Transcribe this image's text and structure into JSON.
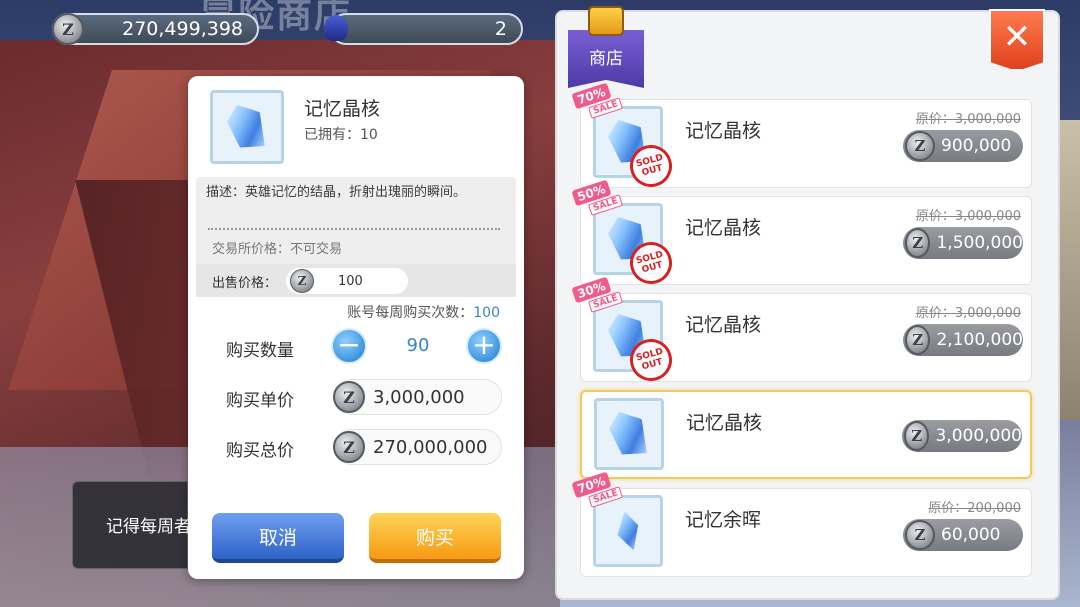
{
  "header": {
    "title": "冒险商店",
    "zeny_amount": "270,499,398",
    "token_amount": "2"
  },
  "detail": {
    "name": "记忆晶核",
    "owned": "已拥有：10",
    "description": "描述：英雄记忆的结晶，折射出瑰丽的瞬间。",
    "trade_price": "交易所价格：不可交易",
    "sell_label": "出售价格：",
    "sell_value": "100",
    "weekly_label": "账号每周购买次数：",
    "weekly_value": "100",
    "qty_label": "购买数量",
    "qty_value": "90",
    "unit_label": "购买单价",
    "unit_value": "3,000,000",
    "total_label": "购买总价",
    "total_value": "270,000,000",
    "cancel_label": "取消",
    "buy_label": "购买"
  },
  "toast": {
    "text": "记得每周者"
  },
  "shop": {
    "tab_label": "商店",
    "close_symbol": "✕",
    "items": [
      {
        "name": "记忆晶核",
        "sale": "70%",
        "sale_word": "SALE",
        "sold_out": "SOLD OUT",
        "orig": "原价：3,000,000",
        "price": "900,000"
      },
      {
        "name": "记忆晶核",
        "sale": "50%",
        "sale_word": "SALE",
        "sold_out": "SOLD OUT",
        "orig": "原价：3,000,000",
        "price": "1,500,000"
      },
      {
        "name": "记忆晶核",
        "sale": "30%",
        "sale_word": "SALE",
        "sold_out": "SOLD OUT",
        "orig": "原价：3,000,000",
        "price": "2,100,000"
      },
      {
        "name": "记忆晶核",
        "price": "3,000,000"
      },
      {
        "name": "记忆余晖",
        "sale": "70%",
        "sale_word": "SALE",
        "orig": "原价：200,000",
        "price": "60,000"
      }
    ]
  },
  "coin_symbol": "Z"
}
